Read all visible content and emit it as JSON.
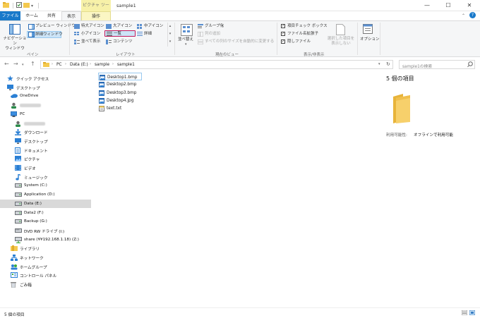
{
  "titlebar": {
    "context_tab": "ピクチャ ツール",
    "title": "sample1",
    "minimize": "—",
    "maximize": "☐",
    "close": "✕"
  },
  "tabs": {
    "file": "ファイル",
    "home": "ホーム",
    "share": "共有",
    "view": "表示",
    "manage": "操作"
  },
  "ribbon": {
    "panes": {
      "nav_pane": "ナビゲーション\nウィンドウ",
      "preview_pane": "プレビュー ウィンドウ",
      "details_pane": "詳細ウィンドウ",
      "group": "ペイン"
    },
    "layout": {
      "xlarge": "特大アイコン",
      "large": "大アイコン",
      "medium": "中アイコン",
      "small": "小アイコン",
      "list": "一覧",
      "details": "詳細",
      "tiles": "並べて表示",
      "content": "コンテンツ",
      "group": "レイアウト"
    },
    "current_view": {
      "sort": "並べ替え",
      "group_by": "グループ化",
      "add_columns": "列の追加",
      "size_all": "すべての列のサイズを自動的に変更する",
      "group": "現在のビュー"
    },
    "show_hide": {
      "item_checkbox": "項目チェック ボックス",
      "file_ext": "ファイル名拡張子",
      "hidden": "隠しファイル",
      "hide_selected": "選択した項目を\n表示しない",
      "group": "表示/非表示"
    },
    "options": "オプション",
    "checkboxes": {
      "item_checkbox": true,
      "file_ext": true,
      "hidden": true
    }
  },
  "address": {
    "crumbs": [
      "PC",
      "Data (E:)",
      "sample",
      "sample1"
    ],
    "search_placeholder": "sample1の検索"
  },
  "nav": [
    {
      "label": "クイック アクセス",
      "icon": "star-icon",
      "indent": 0
    },
    {
      "label": "デスクトップ",
      "icon": "desktop-icon",
      "indent": 0
    },
    {
      "label": "OneDrive",
      "icon": "cloud-icon",
      "indent": 1
    },
    {
      "label": "",
      "icon": "user-icon",
      "indent": 1,
      "blurred": true
    },
    {
      "label": "PC",
      "icon": "pc-icon",
      "indent": 1
    },
    {
      "label": "",
      "icon": "user-icon",
      "indent": 2,
      "blurred": true
    },
    {
      "label": "ダウンロード",
      "icon": "download-icon",
      "indent": 2
    },
    {
      "label": "デスクトップ",
      "icon": "desktop-icon",
      "indent": 2
    },
    {
      "label": "ドキュメント",
      "icon": "document-icon",
      "indent": 2
    },
    {
      "label": "ピクチャ",
      "icon": "picture-icon",
      "indent": 2
    },
    {
      "label": "ビデオ",
      "icon": "video-icon",
      "indent": 2
    },
    {
      "label": "ミュージック",
      "icon": "music-icon",
      "indent": 2
    },
    {
      "label": "System (C:)",
      "icon": "drive-icon",
      "indent": 2
    },
    {
      "label": "Application (D:)",
      "icon": "drive-icon",
      "indent": 2
    },
    {
      "label": "Data (E:)",
      "icon": "drive-icon",
      "indent": 2,
      "selected": true
    },
    {
      "label": "Data2 (F:)",
      "icon": "drive-icon",
      "indent": 2
    },
    {
      "label": "Backup (G:)",
      "icon": "drive-icon",
      "indent": 2
    },
    {
      "label": "DVD RW ドライブ (I:)",
      "icon": "dvd-icon",
      "indent": 2
    },
    {
      "label": "share (¥¥192.168.1.18) (Z:)",
      "icon": "network-drive-icon",
      "indent": 2
    },
    {
      "label": "ライブラリ",
      "icon": "library-icon",
      "indent": 1
    },
    {
      "label": "ネットワーク",
      "icon": "network-icon",
      "indent": 1
    },
    {
      "label": "ホームグループ",
      "icon": "homegroup-icon",
      "indent": 1
    },
    {
      "label": "コントロール パネル",
      "icon": "control-panel-icon",
      "indent": 1
    },
    {
      "label": "ごみ箱",
      "icon": "recycle-bin-icon",
      "indent": 1
    }
  ],
  "files": [
    {
      "name": "Desktop1.bmp",
      "type": "image"
    },
    {
      "name": "Desktop2.bmp",
      "type": "image"
    },
    {
      "name": "Desktop3.bmp",
      "type": "image"
    },
    {
      "name": "Desktop4.jpg",
      "type": "image"
    },
    {
      "name": "text.txt",
      "type": "text"
    }
  ],
  "preview": {
    "count": "5 個の項目",
    "availability_label": "利用可能性:",
    "availability_value": "オフラインで利用可能"
  },
  "status": {
    "count": "5 個の項目"
  },
  "colors": {
    "accent": "#1979ca",
    "highlight": "#c2185b",
    "selected": "#d9d9d9"
  }
}
